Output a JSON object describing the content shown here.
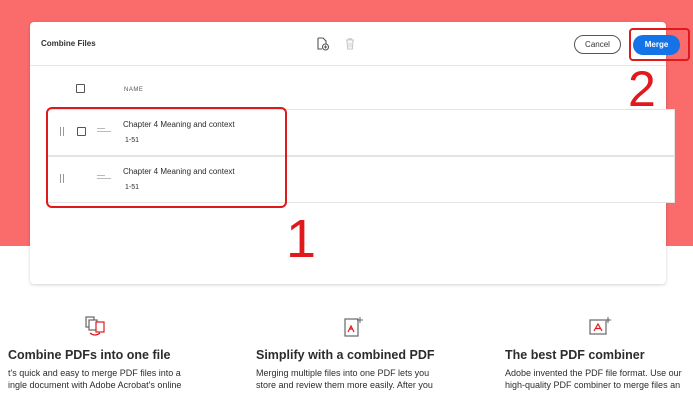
{
  "card": {
    "title": "Combine Files",
    "icons": [
      "add-file-icon",
      "trash-icon"
    ],
    "cancel_label": "Cancel",
    "merge_label": "Merge"
  },
  "list": {
    "column_name": "NAME",
    "files": [
      {
        "name": "Chapter 4 Meaning and context",
        "pages": "1-51"
      },
      {
        "name": "Chapter 4 Meaning and context",
        "pages": "1-51"
      }
    ]
  },
  "annotations": {
    "step_1": "1",
    "step_2": "2",
    "color": "#e0191c"
  },
  "features": [
    {
      "icon": "combine-files-icon",
      "title": "Combine PDFs into one file",
      "lines": [
        "t's quick and easy to merge PDF files into a",
        "ingle document with Adobe Acrobat's online"
      ]
    },
    {
      "icon": "add-pdf-icon",
      "title": "Simplify with a combined PDF",
      "lines": [
        "Merging multiple files into one PDF lets you",
        "store and review them more easily. After you"
      ]
    },
    {
      "icon": "sparkle-pdf-icon",
      "title": "The best PDF combiner",
      "lines": [
        "Adobe invented the PDF file format. Use our",
        "high-quality PDF combiner to merge files an"
      ]
    }
  ],
  "colors": {
    "hero": "#fa6b6b",
    "accent": "#1473e6",
    "annotation": "#e0191c"
  }
}
